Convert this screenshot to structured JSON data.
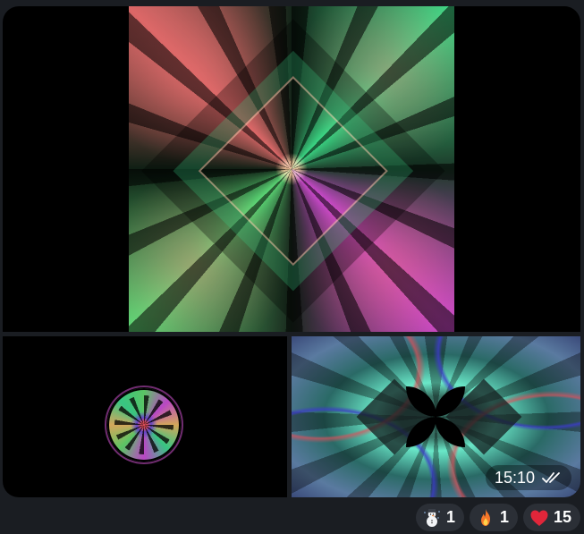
{
  "message": {
    "time": "15:10",
    "read_status_icon": "double-check-icon"
  },
  "album": {
    "photos": [
      {
        "description_icon": "fractal-kaleidoscope-large"
      },
      {
        "description_icon": "fractal-mandala-small"
      },
      {
        "description_icon": "fractal-flower-teal"
      }
    ]
  },
  "reactions": [
    {
      "emoji_icon": "snowman-icon",
      "count": "1"
    },
    {
      "emoji_icon": "fire-icon",
      "count": "1"
    },
    {
      "emoji_icon": "heart-icon",
      "count": "15"
    }
  ],
  "colors": {
    "background": "#1a1d22",
    "reaction_bg": "#2b2f36",
    "heart": "#e0263a",
    "fire": "#f5772a"
  }
}
